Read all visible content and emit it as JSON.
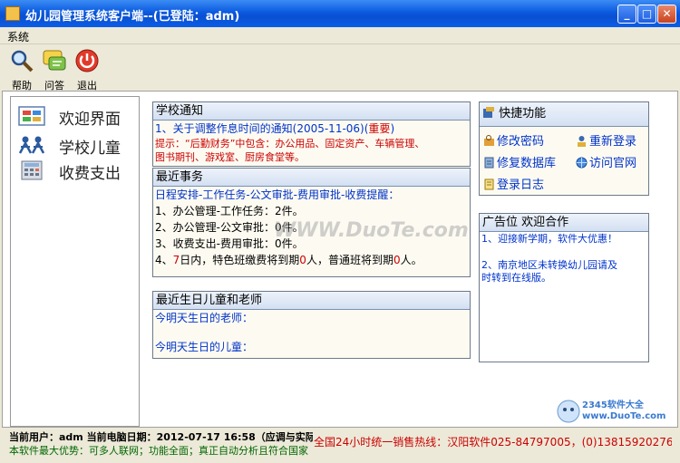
{
  "window": {
    "title": "幼儿园管理系统客户端--(已登陆：adm)"
  },
  "menu": {
    "system": "系统"
  },
  "toolbar": {
    "help": "帮助",
    "qa": "问答",
    "exit": "退出"
  },
  "nav": {
    "items": [
      {
        "label": "欢迎界面",
        "icon": "welcome-icon"
      },
      {
        "label": "学校儿童",
        "icon": "children-icon"
      },
      {
        "label": "收费支出",
        "icon": "calculator-icon"
      }
    ]
  },
  "school_notice": {
    "title": "学校通知",
    "item1_prefix": "1、关于调整作息时间的通知(2005-11-06)(",
    "item1_tag": "重要",
    "item1_suffix": ")",
    "tip_line1": "提示：“后勤财务”中包含：办公用品、固定资产、车辆管理、",
    "tip_line2": "图书期刊、游戏室、厨房食堂等。"
  },
  "recent": {
    "title": "最近事务",
    "header": "日程安排-工作任务-公文审批-费用审批-收费提醒：",
    "line1": "1、办公管理-工作任务：2件。",
    "line2": "2、办公管理-公文审批：0件。",
    "line3": "3、收费支出-费用审批：0件。",
    "line4_a": "4、",
    "line4_b": "7",
    "line4_c": "日内，特色班缴费将到期",
    "line4_d": "0",
    "line4_e": "人，普通班将到期",
    "line4_f": "0",
    "line4_g": "人。"
  },
  "birthday": {
    "title": "最近生日儿童和老师",
    "teachers": "今明天生日的老师：",
    "children": "今明天生日的儿童："
  },
  "quick": {
    "title": "快捷功能",
    "change_pwd": "修改密码",
    "relogin": "重新登录",
    "repair_db": "修复数据库",
    "visit_site": "访问官网",
    "login_log": "登录日志"
  },
  "ad": {
    "title": "广告位  欢迎合作",
    "line1": "1、迎接新学期，软件大优惠！",
    "line2": "2、南京地区未转换幼儿园请及",
    "line3": "时转到在线版。"
  },
  "status": {
    "user_line": "当前用户：adm 当前电脑日期：2012-07-17  16:58（应调与实际",
    "adv_line": "本软件最大优势：可多人联网；功能全面；真正自动分析且符合国家",
    "hotline": "全国24小时统一销售热线：汉阳软件025-84797005，(0)13815920276"
  },
  "watermarks": {
    "center": "WWW.DuoTe.com",
    "corner": "2345软件大全 www.DuoTe.com"
  }
}
